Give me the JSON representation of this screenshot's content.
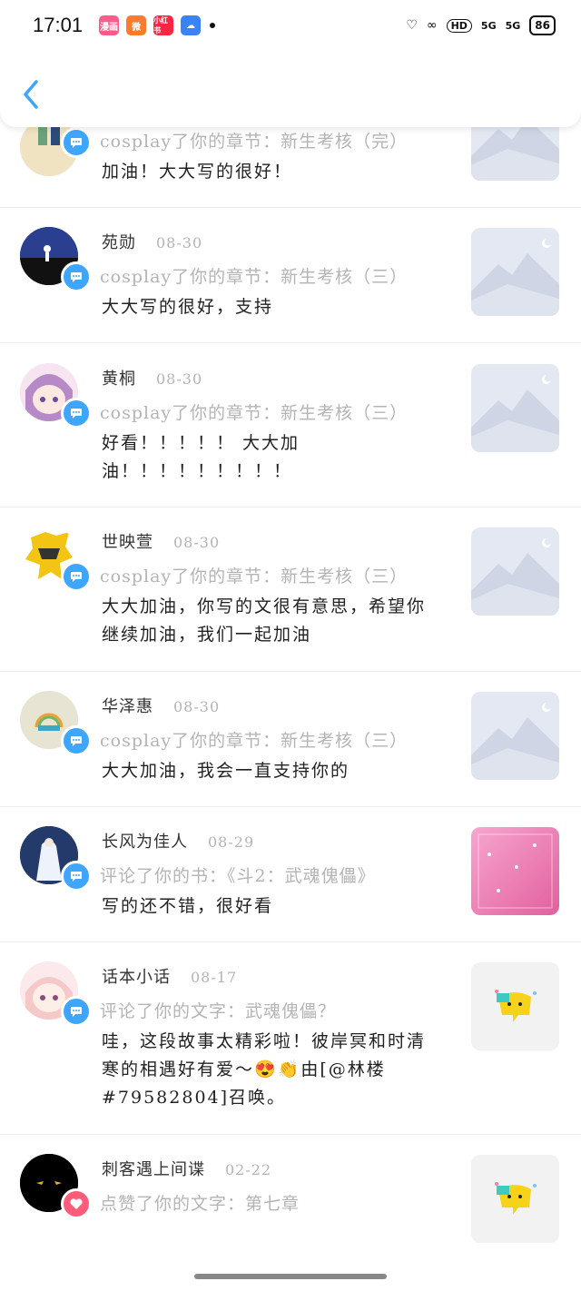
{
  "status_bar": {
    "time": "17:01",
    "apps": [
      {
        "name": "manhua-app-icon",
        "color": "#ff5a8a",
        "text": "漫画"
      },
      {
        "name": "weibo-icon",
        "color": "#ff7a2a",
        "text": "微"
      },
      {
        "name": "xiaohongshu-icon",
        "color": "#ff2442",
        "text": "小红书"
      },
      {
        "name": "cloud-icon",
        "color": "#3b82f6",
        "text": "☁"
      }
    ],
    "signal_1": "5G",
    "signal_2": "5G",
    "hd": "HD",
    "battery": "86"
  },
  "accent_color": "#3fa6ff",
  "notifications": [
    {
      "user": "",
      "date": "",
      "action": "cosplay了你的章节：新生考核（完）",
      "content": "加油！大大写的很好！",
      "badge": "comment",
      "thumb": "placeholder"
    },
    {
      "user": "苑勋",
      "date": "08-30",
      "action": "cosplay了你的章节：新生考核（三）",
      "content": "大大写的很好，支持",
      "badge": "comment",
      "thumb": "placeholder"
    },
    {
      "user": "黄桐",
      "date": "08-30",
      "action": "cosplay了你的章节：新生考核（三）",
      "content": "好看！！！！！ 大大加油！！！！！！！！！",
      "badge": "comment",
      "thumb": "placeholder"
    },
    {
      "user": "世映萱",
      "date": "08-30",
      "action": "cosplay了你的章节：新生考核（三）",
      "content": "大大加油，你写的文很有意思，希望你继续加油，我们一起加油",
      "badge": "comment",
      "thumb": "placeholder"
    },
    {
      "user": "华泽惠",
      "date": "08-30",
      "action": "cosplay了你的章节：新生考核（三）",
      "content": "大大加油，我会一直支持你的",
      "badge": "comment",
      "thumb": "placeholder"
    },
    {
      "user": "长风为佳人",
      "date": "08-29",
      "action": "评论了你的书：《斗2：武魂傀儡》",
      "content": "写的还不错，很好看",
      "badge": "comment",
      "thumb": "book-cover"
    },
    {
      "user": "话本小话",
      "date": "08-17",
      "action": "评论了你的文字：武魂傀儡？",
      "content": "哇，这段故事太精彩啦！彼岸冥和时清寒的相遇好有爱～😍👏由[@林楼#79582804]召唤。",
      "badge": "comment",
      "thumb": "mascot"
    },
    {
      "user": "刺客遇上间谍",
      "date": "02-22",
      "action": "点赞了你的文字：第七章",
      "content": "",
      "badge": "like",
      "thumb": "mascot"
    }
  ]
}
